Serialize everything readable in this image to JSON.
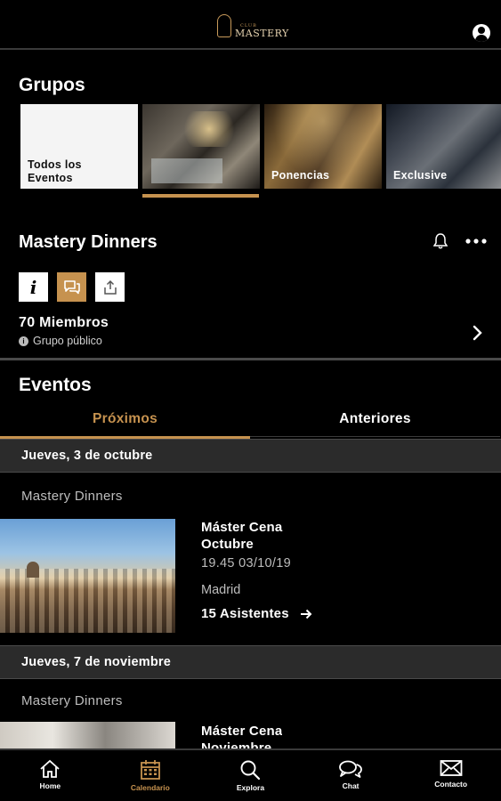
{
  "header": {
    "logo_small": "CLUB",
    "logo_text": "MASTERY"
  },
  "groups": {
    "title": "Grupos",
    "items": [
      {
        "label": "Todos los Eventos"
      },
      {
        "label": ""
      },
      {
        "label": "Ponencias"
      },
      {
        "label": "Exclusive"
      }
    ],
    "selected_index": 1
  },
  "group_detail": {
    "name": "Mastery Dinners",
    "members": "70 Miembros",
    "visibility": "Grupo público",
    "info_icon_glyph": "i"
  },
  "events": {
    "title": "Eventos",
    "tabs": [
      {
        "label": "Próximos",
        "active": true
      },
      {
        "label": "Anteriores",
        "active": false
      }
    ],
    "list": [
      {
        "date_header": "Jueves, 3 de octubre",
        "group": "Mastery Dinners",
        "title_line1": "Máster Cena",
        "title_line2": "Octubre",
        "time": "19.45  03/10/19",
        "location": "Madrid",
        "attendees": "15 Asistentes"
      },
      {
        "date_header": "Jueves, 7 de noviembre",
        "group": "Mastery Dinners",
        "title_line1": "Máster Cena",
        "title_line2": "Noviembre"
      }
    ]
  },
  "bottom_nav": {
    "items": [
      {
        "label": "Home",
        "icon": "home-icon",
        "active": false
      },
      {
        "label": "Calendario",
        "icon": "calendar-icon",
        "active": true
      },
      {
        "label": "Explora",
        "icon": "search-icon",
        "active": false
      },
      {
        "label": "Chat",
        "icon": "chat-icon",
        "active": false
      },
      {
        "label": "Contacto",
        "icon": "mail-icon",
        "active": false
      }
    ]
  },
  "colors": {
    "accent": "#c6924f",
    "background": "#000000",
    "date_bar": "#2b2b2b"
  }
}
